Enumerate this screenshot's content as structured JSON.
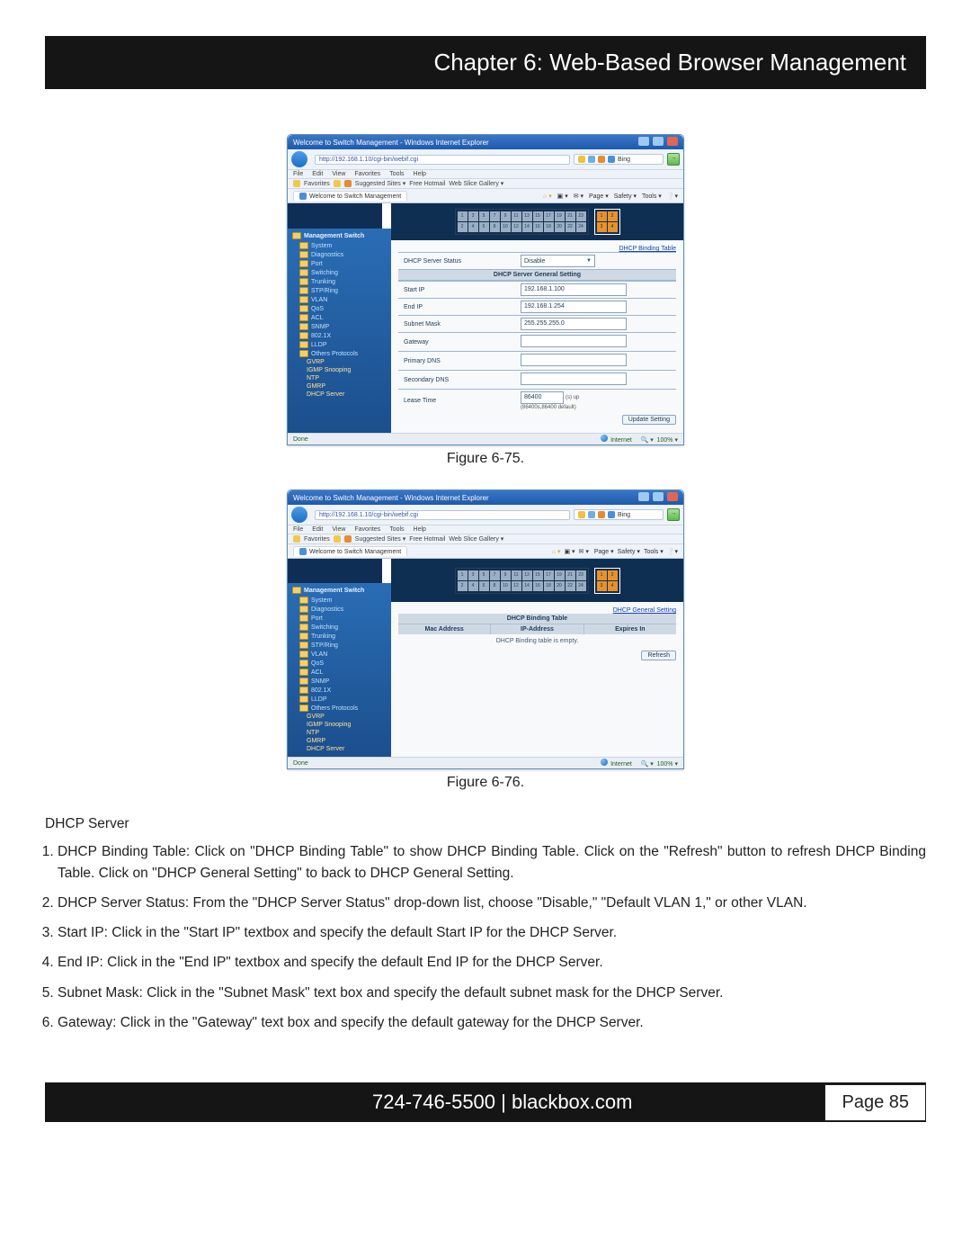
{
  "chapter_title": "Chapter 6: Web-Based Browser Management",
  "browser_title": "Welcome to Switch Management - Windows Internet Explorer",
  "address_url": "http://192.168.1.10/cgi-bin/webif.cgi",
  "menubar": [
    "File",
    "Edit",
    "View",
    "Favorites",
    "Tools",
    "Help"
  ],
  "fav_label": "Favorites",
  "fav_links": [
    "Suggested Sites ▾",
    "Free Hotmail",
    "Web Slice Gallery ▾"
  ],
  "tab_label": "Welcome to Switch Management",
  "toolbar_items": [
    "Page ▾",
    "Safety ▾",
    "Tools ▾"
  ],
  "sidebar": {
    "header": "Management Switch",
    "items": [
      "System",
      "Diagnostics",
      "Port",
      "Switching",
      "Trunking",
      "STP/Ring",
      "VLAN",
      "QoS",
      "ACL",
      "SNMP",
      "802.1X",
      "LLDP"
    ],
    "others_label": "Others Protocols",
    "others": [
      "GVRP",
      "IGMP Snooping",
      "NTP",
      "GMRP",
      "DHCP Server"
    ]
  },
  "ports_top": [
    "1",
    "3",
    "5",
    "7",
    "9",
    "11",
    "13",
    "15",
    "17",
    "19",
    "21",
    "23"
  ],
  "ports_bot": [
    "2",
    "4",
    "6",
    "8",
    "10",
    "12",
    "14",
    "16",
    "18",
    "20",
    "22",
    "24"
  ],
  "gb_ports": [
    "1",
    "2",
    "3",
    "4"
  ],
  "fig1": {
    "link": "DHCP Binding Table",
    "group_title": "DHCP Server General Setting",
    "status_label": "DHCP Server Status",
    "status_value": "Disable",
    "rows": [
      {
        "label": "Start IP",
        "value": "192.168.1.100"
      },
      {
        "label": "End IP",
        "value": "192.168.1.254"
      },
      {
        "label": "Subnet Mask",
        "value": "255.255.255.0"
      },
      {
        "label": "Gateway",
        "value": ""
      },
      {
        "label": "Primary DNS",
        "value": ""
      },
      {
        "label": "Secondary DNS",
        "value": ""
      }
    ],
    "lease_label": "Lease Time",
    "lease_val": "86400",
    "lease_unit": "(s) up",
    "lease_note": "(86400s,86400 default)",
    "button": "Update Setting",
    "caption": "Figure 6-75."
  },
  "fig2": {
    "link": "DHCP General Setting",
    "table_title": "DHCP Binding Table",
    "cols": [
      "Mac Address",
      "IP-Address",
      "Expires In"
    ],
    "empty_msg": "DHCP Binding table is empty.",
    "button": "Refresh",
    "caption": "Figure 6-76."
  },
  "statusbar": {
    "done": "Done",
    "zone": "Internet",
    "zoom": "100%"
  },
  "body": {
    "heading": "DHCP Server",
    "items": [
      "DHCP Binding Table: Click on \"DHCP Binding Table\" to show DHCP Binding Table. Click on the \"Refresh\" button to refresh DHCP Binding Table. Click on \"DHCP General Setting\" to back to DHCP General Setting.",
      "DHCP Server Status: From the \"DHCP Server Status\" drop-down list, choose \"Disable,\" \"Default VLAN 1,\" or other VLAN.",
      "Start IP: Click in the \"Start IP\" textbox and specify the default Start IP for the DHCP Server.",
      "End IP: Click in the \"End IP\" textbox and specify the default End IP for the DHCP Server.",
      "Subnet Mask: Click in the \"Subnet Mask\" text box and specify the default subnet mask for the DHCP Server.",
      "Gateway: Click in the \"Gateway\" text box and specify the default gateway for the DHCP Server."
    ]
  },
  "footer": {
    "contact": "724-746-5500   |   blackbox.com",
    "page": "Page 85"
  }
}
